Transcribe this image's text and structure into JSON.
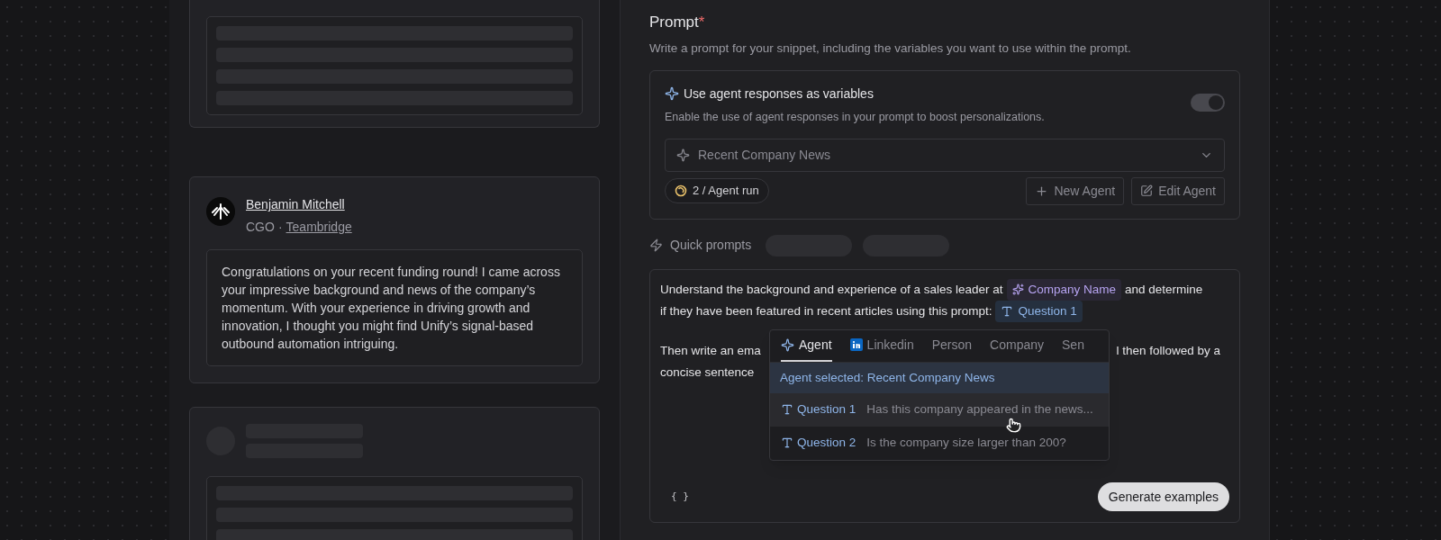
{
  "feed_cards": [
    {
      "kind": "skeleton",
      "header": false
    },
    {
      "kind": "message",
      "name": "Benjamin Mitchell",
      "role": "CGO",
      "separator": "·",
      "company": "Teambridge",
      "message": "Congratulations on your recent funding round! I came across your impressive background and news of the company’s momentum. With your experience in driving growth and innovation, I thought you might find Unify’s signal-based outbound automation intriguing."
    },
    {
      "kind": "skeleton",
      "header": true
    }
  ],
  "prompt": {
    "title": "Prompt",
    "required_mark": "*",
    "description": "Write a prompt for your snippet, including the variables you want to use within the prompt.",
    "agent_panel": {
      "title": "Use agent responses as variables",
      "description": "Enable the use of agent responses in your prompt to boost personalizations.",
      "on": true,
      "agent_select": {
        "value": "Recent Company News"
      },
      "usage": "2 / Agent run",
      "buttons": [
        {
          "kind": "new",
          "label": "New Agent"
        },
        {
          "kind": "edit",
          "label": "Edit Agent"
        }
      ]
    },
    "quick_prompts": {
      "label": "Quick prompts"
    },
    "editor": {
      "paragraph_1": [
        [
          {
            "kind": "text",
            "text": "Understand the background and experience of a sales leader at"
          },
          {
            "kind": "company-variable",
            "text": "Company Name"
          },
          {
            "kind": "text",
            "text": "and determine"
          }
        ],
        [
          {
            "kind": "text",
            "text": "if they have been featured in recent articles using this prompt:"
          },
          {
            "kind": "question-variable",
            "text": "Question 1"
          }
        ]
      ],
      "paragraph_2": {
        "line_start": "Then write an ema",
        "line_end": "l then followed by a",
        "line_2": "concise sentence"
      },
      "braces": "{ }",
      "generate_button": "Generate examples",
      "variable_menu": {
        "tabs": [
          {
            "kind": "agent",
            "label": "Agent",
            "selected": true
          },
          {
            "kind": "linkedin",
            "label": "Linkedin",
            "selected": false
          },
          {
            "kind": "plain",
            "label": "Person",
            "selected": false
          },
          {
            "kind": "plain",
            "label": "Company",
            "selected": false
          },
          {
            "kind": "plain",
            "label": "Sen",
            "selected": false
          }
        ],
        "header": "Agent selected: Recent Company News",
        "items": [
          {
            "label": "Question 1",
            "question": "Has this company appeared in the news...",
            "highlighted": true
          },
          {
            "label": "Question 2",
            "question": "Is the company size larger than 200?",
            "highlighted": false
          }
        ]
      }
    }
  }
}
